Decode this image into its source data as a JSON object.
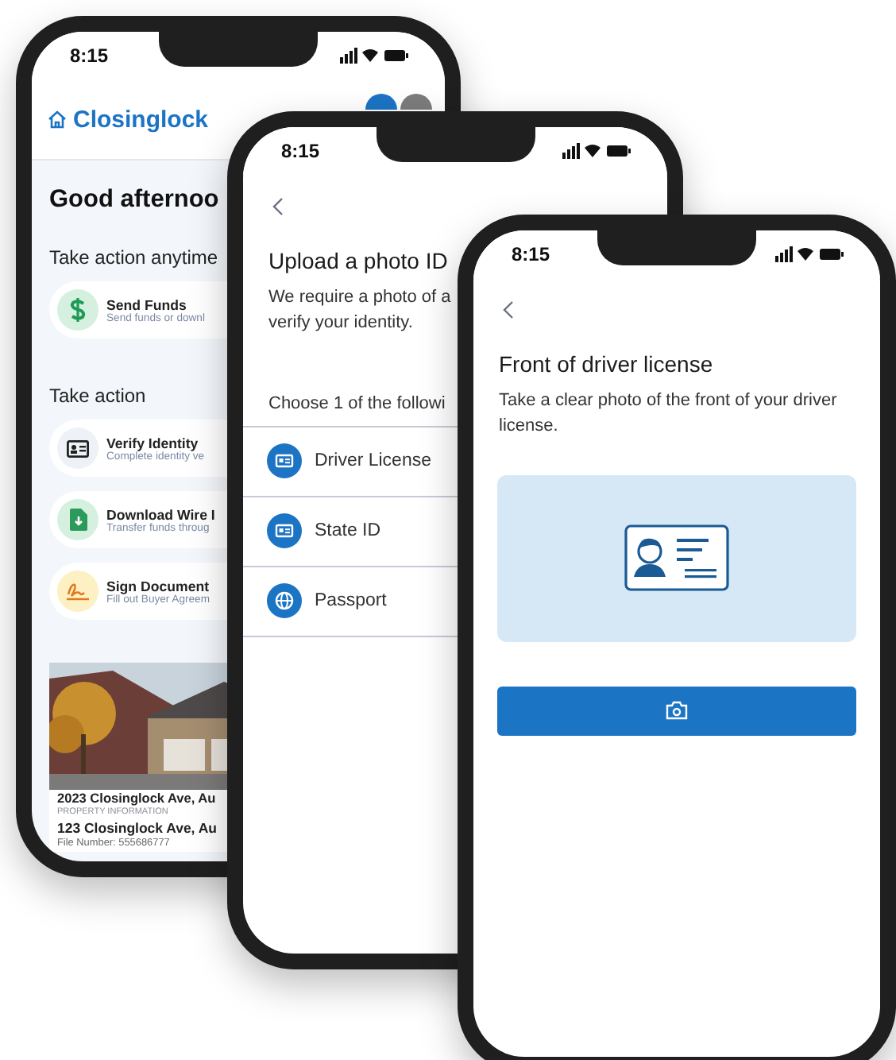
{
  "phones": [
    {
      "kind": "dashboard",
      "time": "8:15",
      "brand": "Closinglock",
      "greeting": "Good afternoo",
      "sections": [
        {
          "title": "Take action anytime",
          "items": [
            {
              "kind": "funds",
              "title": "Send Funds",
              "subtitle": "Send funds or downl"
            }
          ]
        },
        {
          "title": "Take action",
          "items": [
            {
              "kind": "identity",
              "title": "Verify Identity",
              "subtitle": "Complete identity ve"
            },
            {
              "kind": "wire",
              "title": "Download Wire I",
              "subtitle": "Transfer funds throug"
            },
            {
              "kind": "sign",
              "title": "Sign Document",
              "subtitle": "Fill out Buyer Agreem"
            }
          ]
        }
      ],
      "property": {
        "title": "2023 Closinglock Ave, Au",
        "label": "PROPERTY INFORMATION",
        "address": "123 Closinglock Ave, Au",
        "file": "File Number: 555686777"
      }
    },
    {
      "kind": "id-choice",
      "time": "8:15",
      "title": "Upload a photo ID",
      "description": "We require a photo of a",
      "description_2": "verify your identity.",
      "prompt": "Choose 1 of the followi",
      "options": [
        {
          "kind": "card",
          "label": "Driver License"
        },
        {
          "kind": "card",
          "label": "State ID"
        },
        {
          "kind": "globe",
          "label": "Passport"
        }
      ]
    },
    {
      "kind": "capture",
      "time": "8:15",
      "title": "Front of driver license",
      "description": "Take a clear photo of the front of your driver license."
    }
  ]
}
